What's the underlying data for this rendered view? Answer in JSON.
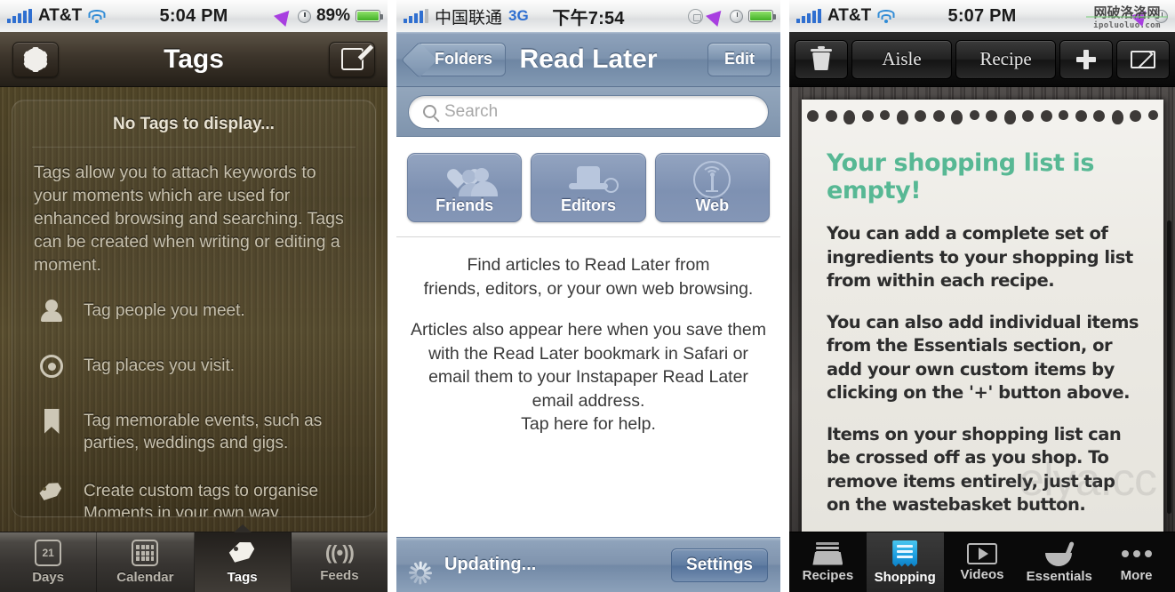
{
  "panel1": {
    "app": "Tags",
    "statusbar": {
      "carrier": "AT&T",
      "time": "5:04 PM",
      "battery_pct": "89%",
      "icons": [
        "signal-bars-icon",
        "wifi-icon",
        "location-arrow-icon",
        "alarm-clock-icon",
        "battery-icon"
      ]
    },
    "nav": {
      "title": "Tags",
      "left_icon": "gear-icon",
      "right_icon": "compose-icon"
    },
    "card": {
      "heading": "No Tags to display...",
      "paragraph": "Tags allow you to attach keywords to your moments which are used for enhanced browsing and searching. Tags can be created when writing or editing a moment.",
      "items": [
        {
          "icon": "person-icon",
          "text": "Tag people you meet."
        },
        {
          "icon": "location-pin-icon",
          "text": "Tag places you visit."
        },
        {
          "icon": "bookmark-icon",
          "text": "Tag memorable events, such as parties, weddings and gigs."
        },
        {
          "icon": "tag-icon",
          "text": "Create custom tags to organise Moments in your own way."
        }
      ]
    },
    "tabs": [
      {
        "label": "Days",
        "icon": "calendar-21-icon",
        "badge": "21",
        "active": false
      },
      {
        "label": "Calendar",
        "icon": "calendar-grid-icon",
        "active": false
      },
      {
        "label": "Tags",
        "icon": "tag-icon",
        "active": true
      },
      {
        "label": "Feeds",
        "icon": "broadcast-icon",
        "active": false
      }
    ]
  },
  "panel2": {
    "app": "Read Later",
    "statusbar": {
      "carrier": "中国联通",
      "network": "3G",
      "time": "下午7:54",
      "icons": [
        "signal-bars-icon",
        "rotation-lock-icon",
        "location-arrow-icon",
        "alarm-clock-icon",
        "battery-icon"
      ]
    },
    "nav": {
      "back_label": "Folders",
      "title": "Read Later",
      "edit_label": "Edit"
    },
    "search": {
      "placeholder": "Search",
      "icon": "search-icon"
    },
    "categories": [
      {
        "label": "Friends",
        "icon": "heart-people-icon"
      },
      {
        "label": "Editors",
        "icon": "top-hat-monocle-icon"
      },
      {
        "label": "Web",
        "icon": "broadcast-antenna-icon"
      }
    ],
    "body": [
      "Find articles to Read Later from\nfriends, editors, or your own web browsing.",
      "Articles also appear here when you save them with the Read Later bookmark in Safari or email them to your Instapaper Read Later email address.\nTap here for help."
    ],
    "bottom": {
      "status": "Updating...",
      "spinner_icon": "loading-spinner-icon",
      "settings_label": "Settings"
    }
  },
  "panel3": {
    "app": "Shopping",
    "statusbar": {
      "carrier": "AT&T",
      "time": "5:07 PM",
      "icons": [
        "signal-bars-icon",
        "wifi-icon",
        "location-arrow-icon",
        "alarm-clock-icon"
      ]
    },
    "watermark": {
      "top": "网破洛洛网",
      "bottom": "ipoluoluo.com"
    },
    "toolbar": [
      {
        "label": "",
        "icon": "trash-icon"
      },
      {
        "label": "Aisle",
        "icon": ""
      },
      {
        "label": "Recipe",
        "icon": ""
      },
      {
        "label": "",
        "icon": "plus-icon"
      },
      {
        "label": "",
        "icon": "envelope-icon"
      }
    ],
    "note": {
      "heading": "Your shopping list is empty!",
      "paragraphs": [
        "You can add a complete set of ingredients to your shopping list from within each recipe.",
        "You can also add individual items from the Essentials section, or add your own custom items by clicking on the '+' button above.",
        "Items on your shopping list can be crossed off as you shop. To remove items entirely, just tap on the wastebasket button."
      ],
      "watermark": "elya.cc"
    },
    "tabs": [
      {
        "label": "Recipes",
        "icon": "recipe-box-icon",
        "active": false
      },
      {
        "label": "Shopping",
        "icon": "receipt-icon",
        "active": true
      },
      {
        "label": "Videos",
        "icon": "video-screen-icon",
        "active": false
      },
      {
        "label": "Essentials",
        "icon": "mortar-pestle-icon",
        "active": false
      },
      {
        "label": "More",
        "icon": "ellipsis-icon",
        "active": false
      }
    ]
  },
  "colors": {
    "wood_brown": "#534829",
    "ios_blue": "#7d93ae",
    "note_green": "#57b894",
    "shopping_blue": "#1e9fe0"
  }
}
